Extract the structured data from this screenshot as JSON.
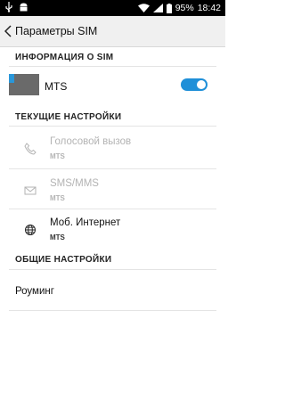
{
  "status_bar": {
    "battery": "95%",
    "time": "18:42"
  },
  "appbar": {
    "title": "Параметры SIM"
  },
  "sim_info": {
    "section_title": "ИНФОРМАЦИЯ О SIM",
    "sim_name": "MTS",
    "enabled": true
  },
  "current_settings": {
    "section_title": "ТЕКУЩИЕ НАСТРОЙКИ",
    "items": [
      {
        "label": "Голосовой вызов",
        "sub": "MTS",
        "icon": "phone-icon",
        "enabled": false
      },
      {
        "label": "SMS/MMS",
        "sub": "MTS",
        "icon": "envelope-icon",
        "enabled": false
      },
      {
        "label": "Моб. Интернет",
        "sub": "MTS",
        "icon": "globe-icon",
        "enabled": true
      }
    ]
  },
  "general_settings": {
    "section_title": "ОБЩИЕ НАСТРОЙКИ",
    "roaming_label": "Роуминг"
  },
  "colors": {
    "accent": "#1f8fd8",
    "sim_color": "#2a97d9"
  }
}
